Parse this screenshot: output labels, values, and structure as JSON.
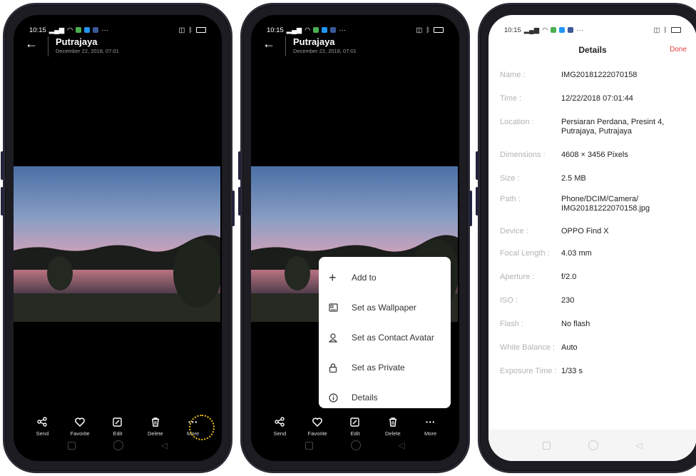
{
  "status_bar": {
    "time": "10:15",
    "dots": "···"
  },
  "photo_view": {
    "title": "Putrajaya",
    "subtitle": "December 22, 2018, 07:01"
  },
  "toolbar": [
    {
      "label": "Send",
      "icon": "share-icon"
    },
    {
      "label": "Favorite",
      "icon": "heart-icon"
    },
    {
      "label": "Edit",
      "icon": "edit-icon"
    },
    {
      "label": "Delete",
      "icon": "trash-icon"
    },
    {
      "label": "More",
      "icon": "more-icon"
    }
  ],
  "more_menu": [
    {
      "label": "Add to",
      "icon": "plus-icon"
    },
    {
      "label": "Set as Wallpaper",
      "icon": "wallpaper-icon"
    },
    {
      "label": "Set as Contact Avatar",
      "icon": "person-icon"
    },
    {
      "label": "Set as Private",
      "icon": "lock-icon"
    },
    {
      "label": "Details",
      "icon": "info-icon"
    }
  ],
  "details": {
    "title": "Details",
    "done": "Done",
    "rows": [
      {
        "key": "Name :",
        "value": "IMG20181222070158"
      },
      {
        "key": "Time :",
        "value": "12/22/2018 07:01:44"
      },
      {
        "key": "Location :",
        "value": "Persiaran Perdana, Presint 4, Putrajaya, Putrajaya"
      },
      {
        "key": "Dimensions :",
        "value": "4608 × 3456 Pixels"
      },
      {
        "key": "Size :",
        "value": "2.5 MB"
      },
      {
        "key": "Path :",
        "value": "Phone/DCIM/Camera/ IMG20181222070158.jpg"
      },
      {
        "key": "Device :",
        "value": "OPPO Find X"
      },
      {
        "key": "Focal Length :",
        "value": "4.03 mm"
      },
      {
        "key": "Aperture :",
        "value": "f/2.0"
      },
      {
        "key": "ISO :",
        "value": "230"
      },
      {
        "key": "Flash :",
        "value": "No flash"
      },
      {
        "key": "White Balance :",
        "value": "Auto"
      },
      {
        "key": "Exposure Time :",
        "value": "1/33 s"
      }
    ]
  },
  "colors": {
    "accent_done": "#e23a3a",
    "more_ring": "#f5c518"
  }
}
